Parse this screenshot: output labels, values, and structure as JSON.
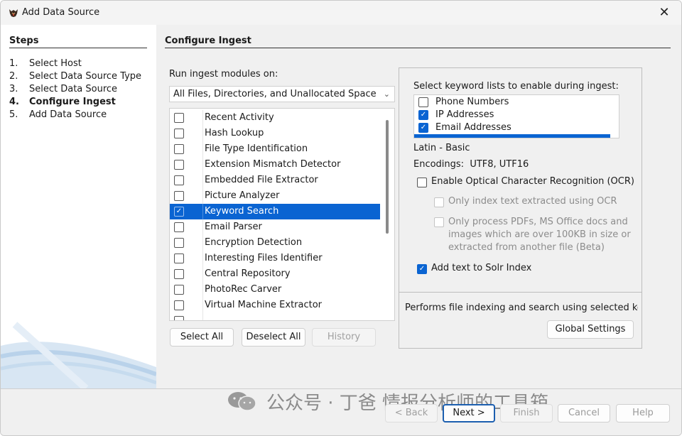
{
  "window": {
    "title": "Add Data Source",
    "close_icon": "close-icon",
    "app_icon": "autopsy-dog-icon"
  },
  "steps": {
    "heading": "Steps",
    "items": [
      {
        "num": "1.",
        "label": "Select Host"
      },
      {
        "num": "2.",
        "label": "Select Data Source Type"
      },
      {
        "num": "3.",
        "label": "Select Data Source"
      },
      {
        "num": "4.",
        "label": "Configure Ingest",
        "active": true
      },
      {
        "num": "5.",
        "label": "Add Data Source"
      }
    ]
  },
  "main": {
    "title": "Configure Ingest",
    "run_label": "Run ingest modules on:",
    "run_select_value": "All Files, Directories, and Unallocated Space",
    "modules": [
      {
        "label": "Recent Activity",
        "checked": false
      },
      {
        "label": "Hash Lookup",
        "checked": false
      },
      {
        "label": "File Type Identification",
        "checked": false
      },
      {
        "label": "Extension Mismatch Detector",
        "checked": false
      },
      {
        "label": "Embedded File Extractor",
        "checked": false
      },
      {
        "label": "Picture Analyzer",
        "checked": false
      },
      {
        "label": "Keyword Search",
        "checked": true,
        "selected": true
      },
      {
        "label": "Email Parser",
        "checked": false
      },
      {
        "label": "Encryption Detection",
        "checked": false
      },
      {
        "label": "Interesting Files Identifier",
        "checked": false
      },
      {
        "label": "Central Repository",
        "checked": false
      },
      {
        "label": "PhotoRec Carver",
        "checked": false
      },
      {
        "label": "Virtual Machine Extractor",
        "checked": false
      }
    ],
    "buttons": {
      "select_all": "Select All",
      "deselect_all": "Deselect All",
      "history": "History"
    }
  },
  "settings": {
    "keyword_label": "Select keyword lists to enable during ingest:",
    "keyword_lists": [
      {
        "label": "Phone Numbers",
        "checked": false
      },
      {
        "label": "IP Addresses",
        "checked": true
      },
      {
        "label": "Email Addresses",
        "checked": true
      }
    ],
    "script_line": "Latin - Basic",
    "encodings_label": "Encodings:",
    "encodings_value": "UTF8, UTF16",
    "ocr_label": "Enable Optical Character Recognition (OCR)",
    "ocr_only_index": "Only index text extracted using OCR",
    "ocr_only_process": [
      "Only process PDFs, MS Office docs and",
      "images which are over 100KB in size or",
      "extracted from another file (Beta)"
    ],
    "solr_label": "Add text to Solr Index",
    "description": "Performs file indexing and search using selected keywo",
    "global_settings": "Global Settings"
  },
  "footer": {
    "back": "< Back",
    "next": "Next >",
    "finish": "Finish",
    "cancel": "Cancel",
    "help": "Help",
    "watermark": "公众号 · 丁爸 情报分析师的工具箱"
  },
  "colors": {
    "selection": "#0a64d2",
    "panel_bg": "#f0f0f0"
  }
}
